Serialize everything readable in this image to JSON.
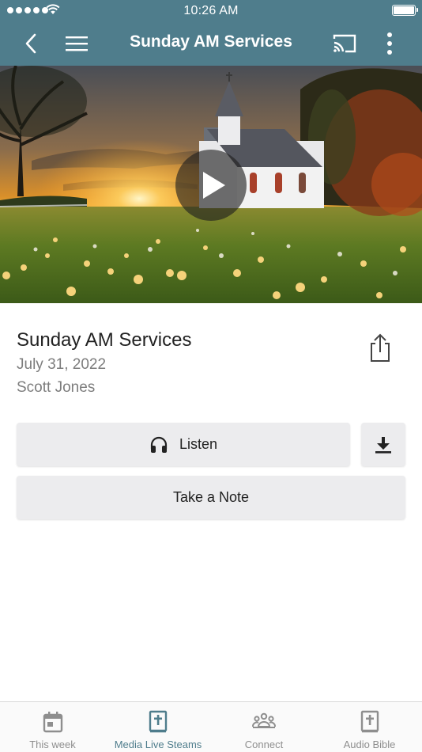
{
  "status_bar": {
    "time": "10:26 AM"
  },
  "header": {
    "title": "Sunday AM Services",
    "back_icon": "chevron-left-icon",
    "menu_icon": "hamburger-menu-icon",
    "cast_icon": "cast-icon",
    "more_icon": "more-vertical-icon",
    "color": "#4f7d8c"
  },
  "media": {
    "thumbnail": "church-sunset-dandelions",
    "play_icon": "play-icon"
  },
  "details": {
    "title": "Sunday AM Services",
    "date": "July 31, 2022",
    "speaker": "Scott Jones",
    "share_icon": "share-icon"
  },
  "actions": {
    "listen_label": "Listen",
    "listen_icon": "headphones-icon",
    "download_icon": "download-icon",
    "note_label": "Take a Note"
  },
  "tabbar": {
    "accent": "#4f7d8c",
    "inactive": "#8e8e8e",
    "items": [
      {
        "label": "This week",
        "icon": "calendar-icon",
        "active": false
      },
      {
        "label": "Media Live Steams",
        "icon": "bible-icon",
        "active": true
      },
      {
        "label": "Connect",
        "icon": "people-icon",
        "active": false
      },
      {
        "label": "Audio Bible",
        "icon": "bible-icon",
        "active": false
      }
    ]
  }
}
